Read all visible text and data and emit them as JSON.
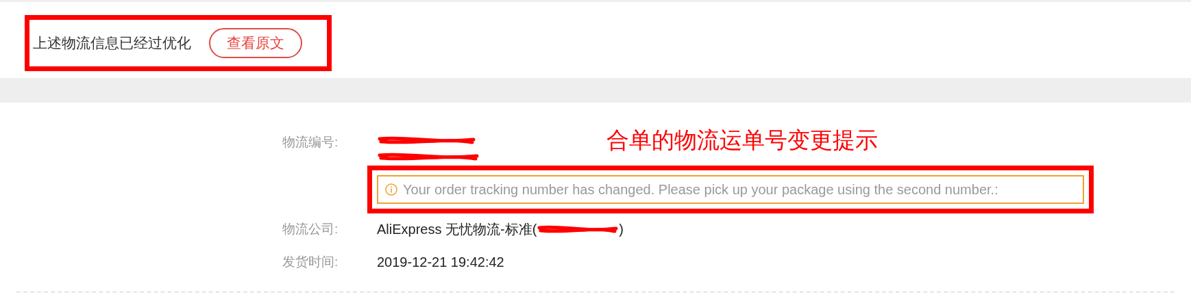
{
  "optimization_bar": {
    "text": "上述物流信息已经过优化",
    "button": "查看原文"
  },
  "annotation_note": "合单的物流运单号变更提示",
  "shipment": {
    "tracking_label": "物流编号:",
    "tracking_numbers": [
      {
        "kind": "redacted"
      },
      {
        "kind": "redacted"
      }
    ],
    "notice": "Your order tracking number has changed. Please pick up your package using the second number.:",
    "company_label": "物流公司:",
    "company_prefix": "AliExpress 无忧物流-标准(",
    "company_suffix": ")",
    "date_label": "发货时间:",
    "date": "2019-12-21 19:42:42"
  }
}
